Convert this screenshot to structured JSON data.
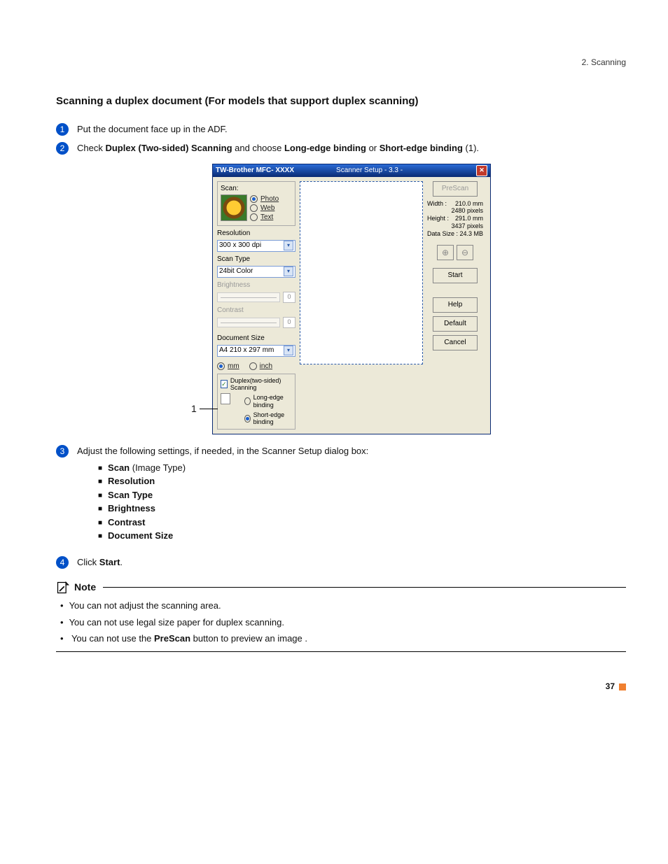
{
  "header": {
    "breadcrumb": "2. Scanning"
  },
  "title": "Scanning a duplex document (For models that support duplex scanning)",
  "steps": {
    "s1": {
      "n": "1",
      "text": "Put the document face up in the ADF."
    },
    "s2": {
      "n": "2",
      "prefix": "Check ",
      "duplex_label": "Duplex (Two-sided) Scanning",
      "mid": " and choose ",
      "long_edge": "Long-edge binding",
      "or": " or ",
      "short_edge": "Short-edge binding",
      "suffix": " (1)."
    },
    "s3": {
      "n": "3",
      "intro": "Adjust the following settings, if needed, in the Scanner Setup dialog box:",
      "items": {
        "i1a": "Scan",
        "i1b": " (Image Type)",
        "i2": "Resolution",
        "i3": "Scan Type",
        "i4": "Brightness",
        "i5": "Contrast",
        "i6": "Document Size"
      }
    },
    "s4": {
      "n": "4",
      "pre": "Click ",
      "btn": "Start",
      "post": "."
    }
  },
  "note": {
    "heading": "Note",
    "b1": "You can not adjust the scanning area.",
    "b2": "You can not use legal size paper for duplex scanning.",
    "b3a": "You can not use the ",
    "b3b": "PreScan",
    "b3c": " button to preview an image ."
  },
  "page_number": "37",
  "callout_label": "1",
  "dialog": {
    "title_app": "TW-Brother MFC- XXXX",
    "title_setup": "Scanner Setup - 3.3 -",
    "scan_group_label": "Scan:",
    "scan_photo": "Photo",
    "scan_web": "Web",
    "scan_text": "Text",
    "resolution_label": "Resolution",
    "resolution_value": "300 x 300 dpi",
    "scantype_label": "Scan Type",
    "scantype_value": "24bit Color",
    "brightness_label": "Brightness",
    "brightness_value": "0",
    "contrast_label": "Contrast",
    "contrast_value": "0",
    "docsize_label": "Document Size",
    "docsize_value": "A4 210 x 297 mm",
    "unit_mm": "mm",
    "unit_inch": "inch",
    "duplex_check": "Duplex(two-sided) Scanning",
    "long_edge": "Long-edge binding",
    "short_edge": "Short-edge binding",
    "prescan": "PreScan",
    "info": {
      "width_label": "Width :",
      "width_mm": "210.0 mm",
      "width_px": "2480 pixels",
      "height_label": "Height :",
      "height_mm": "291.0 mm",
      "height_px": "3437 pixels",
      "datasize_label": "Data Size :",
      "datasize": "24.3 MB"
    },
    "start": "Start",
    "help": "Help",
    "default": "Default",
    "cancel": "Cancel"
  }
}
